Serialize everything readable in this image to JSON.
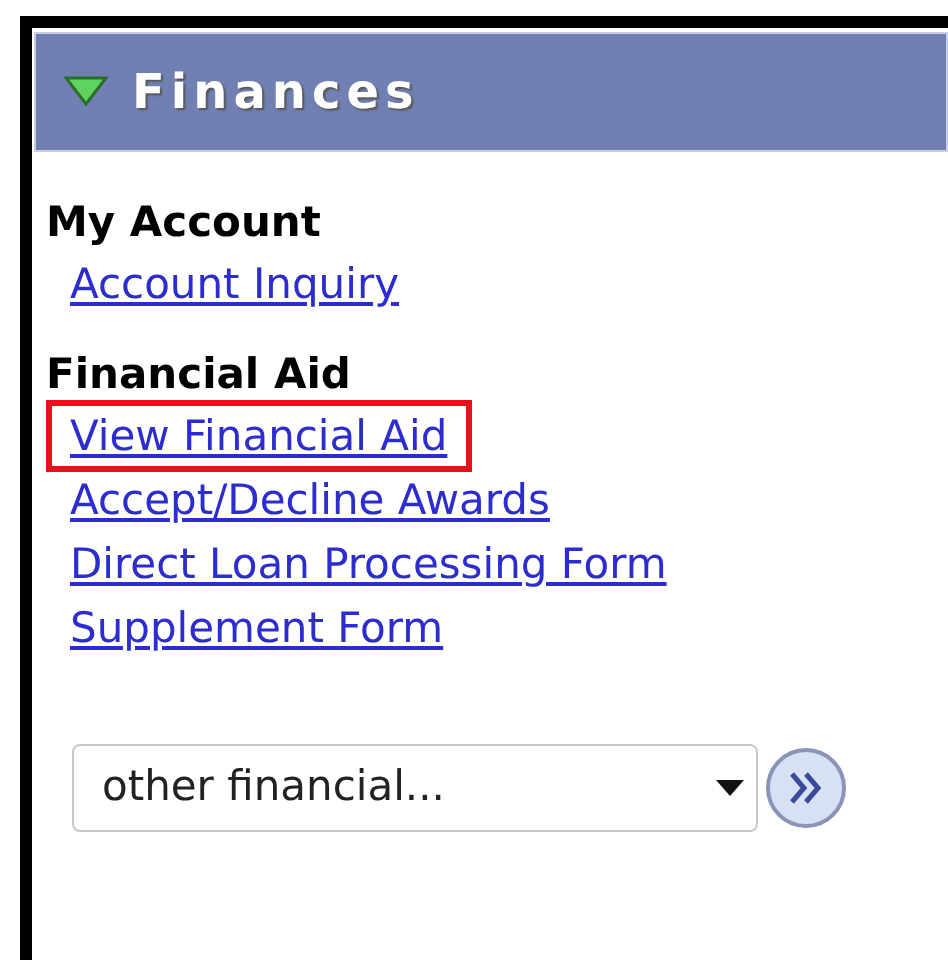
{
  "panel": {
    "title": "Finances",
    "expanded": true
  },
  "sections": [
    {
      "heading": "My Account",
      "links": [
        {
          "label": "Account Inquiry",
          "highlighted": false
        }
      ]
    },
    {
      "heading": "Financial Aid",
      "links": [
        {
          "label": "View Financial Aid",
          "highlighted": true
        },
        {
          "label": "Accept/Decline Awards",
          "highlighted": false
        },
        {
          "label": "Direct Loan Processing Form",
          "highlighted": false
        },
        {
          "label": "Supplement Form",
          "highlighted": false
        }
      ]
    }
  ],
  "dropdown": {
    "value": "other financial..."
  }
}
